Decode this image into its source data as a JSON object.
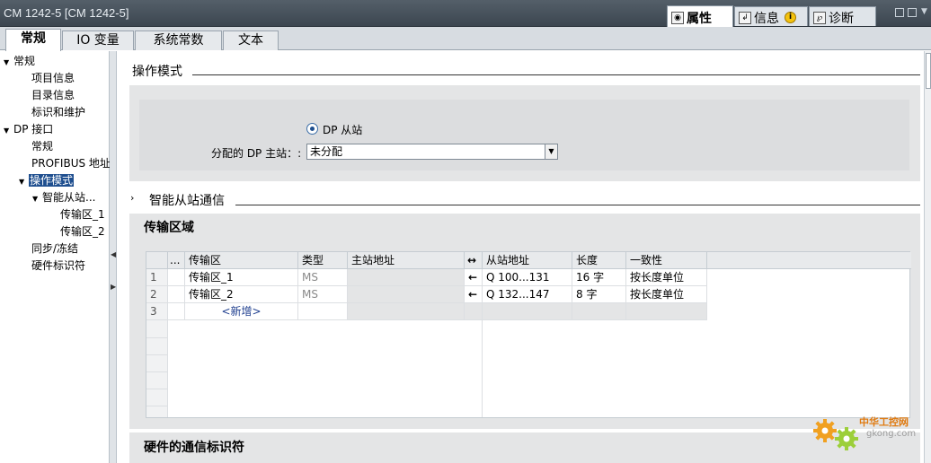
{
  "window": {
    "title": "CM 1242-5 [CM 1242-5]"
  },
  "inspector_tabs": [
    {
      "label": "属性",
      "active": true,
      "icon": "properties-icon"
    },
    {
      "label": "信息",
      "active": false,
      "icon": "info-icon",
      "badge": "i"
    },
    {
      "label": "诊断",
      "active": false,
      "icon": "diagnostics-icon"
    }
  ],
  "tabs": [
    {
      "label": "常规",
      "active": true
    },
    {
      "label": "IO 变量",
      "active": false
    },
    {
      "label": "系统常数",
      "active": false
    },
    {
      "label": "文本",
      "active": false
    }
  ],
  "tree": [
    {
      "label": "常规",
      "level": 0,
      "expanded": true
    },
    {
      "label": "项目信息",
      "level": 1
    },
    {
      "label": "目录信息",
      "level": 1
    },
    {
      "label": "标识和维护",
      "level": 1
    },
    {
      "label": "DP 接口",
      "level": 0,
      "expanded": true
    },
    {
      "label": "常规",
      "level": 1
    },
    {
      "label": "PROFIBUS 地址",
      "level": 1
    },
    {
      "label": "操作模式",
      "level": 1,
      "expanded": true,
      "selected": true
    },
    {
      "label": "智能从站...",
      "level": 2,
      "expanded": true
    },
    {
      "label": "传输区_1",
      "level": 3
    },
    {
      "label": "传输区_2",
      "level": 3
    },
    {
      "label": "同步/冻结",
      "level": 1
    },
    {
      "label": "硬件标识符",
      "level": 1
    }
  ],
  "operating_mode": {
    "section_title": "操作模式",
    "radio_label": "DP 从站",
    "master_label": "分配的 DP 主站：:",
    "master_value": "未分配"
  },
  "smart_slave": {
    "section_title": "智能从站通信",
    "area_title": "传输区域",
    "columns": [
      "...",
      "传输区",
      "类型",
      "主站地址",
      "↔",
      "从站地址",
      "长度",
      "一致性"
    ],
    "rows": [
      {
        "num": "1",
        "name": "传输区_1",
        "type": "MS",
        "master_addr": "",
        "dir": "←",
        "slave_addr": "Q 100...131",
        "length": "16 字",
        "consistency": "按长度单位"
      },
      {
        "num": "2",
        "name": "传输区_2",
        "type": "MS",
        "master_addr": "",
        "dir": "←",
        "slave_addr": "Q 132...147",
        "length": "8 字",
        "consistency": "按长度单位"
      },
      {
        "num": "3",
        "name": "<新增>",
        "type": "",
        "master_addr": "",
        "dir": "",
        "slave_addr": "",
        "length": "",
        "consistency": ""
      }
    ]
  },
  "hw_section": {
    "title": "硬件的通信标识符"
  },
  "watermark": {
    "line1": "中华工控网",
    "line2": "gkong.com"
  }
}
